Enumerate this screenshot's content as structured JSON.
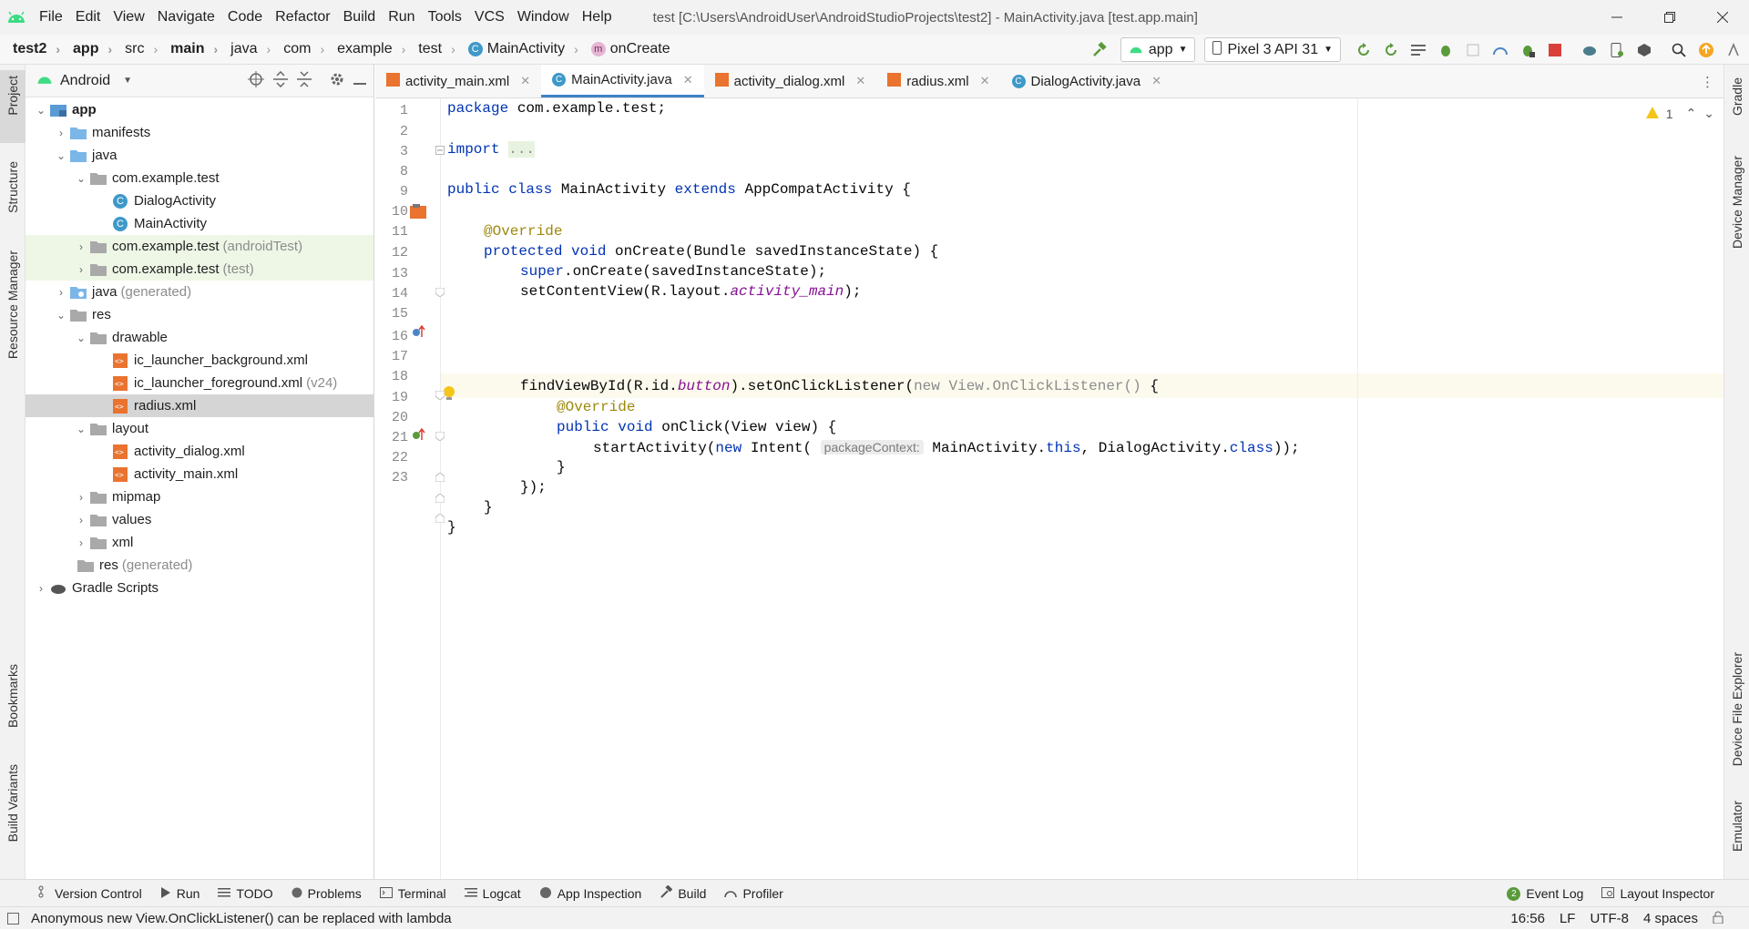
{
  "window": {
    "title": "test [C:\\Users\\AndroidUser\\AndroidStudioProjects\\test2] - MainActivity.java [test.app.main]"
  },
  "menu": [
    {
      "label": "File"
    },
    {
      "label": "Edit"
    },
    {
      "label": "View"
    },
    {
      "label": "Navigate"
    },
    {
      "label": "Code"
    },
    {
      "label": "Refactor"
    },
    {
      "label": "Build"
    },
    {
      "label": "Run"
    },
    {
      "label": "Tools"
    },
    {
      "label": "VCS"
    },
    {
      "label": "Window"
    },
    {
      "label": "Help"
    }
  ],
  "breadcrumb": [
    "test2",
    "app",
    "src",
    "main",
    "java",
    "com",
    "example",
    "test",
    "MainActivity",
    "onCreate"
  ],
  "toolbar": {
    "run_config": "app",
    "device": "Pixel 3 API 31"
  },
  "left_tools": {
    "project": "Project",
    "structure": "Structure",
    "resource_manager": "Resource Manager",
    "bookmarks": "Bookmarks",
    "build_variants": "Build Variants"
  },
  "right_tools": {
    "gradle": "Gradle",
    "device_manager": "Device Manager",
    "device_file_explorer": "Device File Explorer",
    "emulator": "Emulator"
  },
  "project_panel": {
    "view_mode": "Android",
    "tree": [
      {
        "label": "app",
        "hint": ""
      },
      {
        "label": "manifests",
        "hint": ""
      },
      {
        "label": "java",
        "hint": ""
      },
      {
        "label": "com.example.test",
        "hint": ""
      },
      {
        "label": "DialogActivity",
        "hint": ""
      },
      {
        "label": "MainActivity",
        "hint": ""
      },
      {
        "label": "com.example.test",
        "hint": "(androidTest)"
      },
      {
        "label": "com.example.test",
        "hint": "(test)"
      },
      {
        "label": "java",
        "hint": "(generated)"
      },
      {
        "label": "res",
        "hint": ""
      },
      {
        "label": "drawable",
        "hint": ""
      },
      {
        "label": "ic_launcher_background.xml",
        "hint": ""
      },
      {
        "label": "ic_launcher_foreground.xml",
        "hint": "(v24)"
      },
      {
        "label": "radius.xml",
        "hint": ""
      },
      {
        "label": "layout",
        "hint": ""
      },
      {
        "label": "activity_dialog.xml",
        "hint": ""
      },
      {
        "label": "activity_main.xml",
        "hint": ""
      },
      {
        "label": "mipmap",
        "hint": ""
      },
      {
        "label": "values",
        "hint": ""
      },
      {
        "label": "xml",
        "hint": ""
      },
      {
        "label": "res",
        "hint": "(generated)"
      },
      {
        "label": "Gradle Scripts",
        "hint": ""
      }
    ]
  },
  "editor_tabs": [
    {
      "label": "activity_main.xml"
    },
    {
      "label": "MainActivity.java"
    },
    {
      "label": "activity_dialog.xml"
    },
    {
      "label": "radius.xml"
    },
    {
      "label": "DialogActivity.java"
    }
  ],
  "editor": {
    "warning_count": "1",
    "line_numbers": [
      "1",
      "2",
      "3",
      "8",
      "9",
      "10",
      "11",
      "12",
      "13",
      "14",
      "15",
      "16",
      "17",
      "18",
      "19",
      "20",
      "21",
      "22",
      "23"
    ],
    "code": {
      "l1_kw": "package",
      "l1_rest": " com.example.test;",
      "l3_kw": "import",
      "l3_dots": "...",
      "l9_kw1": "public class",
      "l9_name": " MainActivity ",
      "l9_kw2": "extends",
      "l9_rest": " AppCompatActivity {",
      "l11": "@Override",
      "l12_kw": "protected void",
      "l12_rest": " onCreate(Bundle savedInstanceState) {",
      "l13_kw": "super",
      "l13_rest": ".onCreate(savedInstanceState);",
      "l14_a": "setContentView(R.layout.",
      "l14_f": "activity_main",
      "l14_b": ");",
      "l16_a": "findViewById(R.id.",
      "l16_f": "button",
      "l16_b": ").setOnClickListener(",
      "l16_new": "new",
      "l16_c": " View.OnClickListener()",
      "l16_d": " {",
      "l17": "@Override",
      "l18_kw": "public void",
      "l18_rest": " onClick(View view) {",
      "l19_a": "startActivity(",
      "l19_kw": "new",
      "l19_b": " Intent( ",
      "l19_hint": "packageContext:",
      "l19_c": " MainActivity.",
      "l19_this": "this",
      "l19_d": ", DialogActivity.",
      "l19_cls": "class",
      "l19_e": "));",
      "l20": "}",
      "l21": "});",
      "l22": "}",
      "l23": "}"
    }
  },
  "bottom_tools": {
    "version_control": "Version Control",
    "run": "Run",
    "todo": "TODO",
    "problems": "Problems",
    "terminal": "Terminal",
    "logcat": "Logcat",
    "app_inspection": "App Inspection",
    "build": "Build",
    "profiler": "Profiler",
    "event_log_count": "2",
    "event_log": "Event Log",
    "layout_inspector": "Layout Inspector"
  },
  "status": {
    "message": "Anonymous new View.OnClickListener() can be replaced with lambda",
    "position": "16:56",
    "line_sep": "LF",
    "encoding": "UTF-8",
    "indent": "4 spaces"
  },
  "colors": {
    "accent": "#4083c9",
    "keyword": "#0033b3",
    "annotation": "#9e880d",
    "field": "#871094",
    "android_green": "#3ddc84"
  }
}
